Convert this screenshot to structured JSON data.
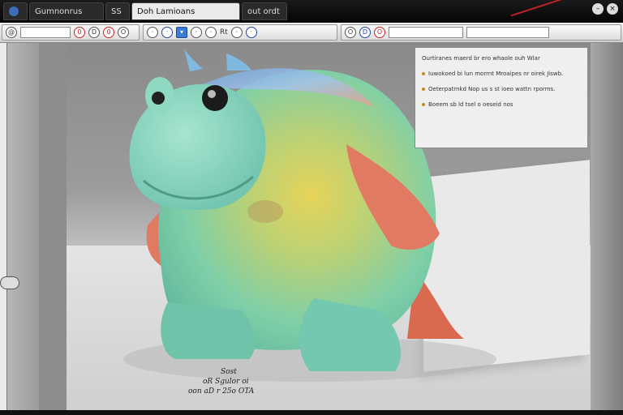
{
  "title_tabs": [
    "Gumnonrus",
    "SS",
    "Doh Lamioans",
    "out ordt"
  ],
  "window_controls": [
    "min",
    "max",
    "close"
  ],
  "toolbar": {
    "left_labels": [
      "@",
      "0",
      "D",
      "0",
      "O"
    ],
    "middle_label": "Rt",
    "right_labels": [
      "O",
      "D",
      "O"
    ]
  },
  "note": {
    "intro": "Ourtiranes maerd br ero whaole ouh Wlar",
    "items": [
      "Iuwokoed bi lun morrnt Mroaipes nr oirek Jiswb.",
      "Oeterpatrnkd Nop us s st ioeo wattn rporms.",
      "Boeem sb ld tsel o oeseid nos"
    ]
  },
  "caption": {
    "line1": "Sost",
    "line2": "oR Sgulor oi",
    "line3": "oon aD r 25o OTA"
  },
  "colors": {
    "titlebar": "#0a0a0a",
    "toolbar": "#dcdcdc",
    "selected": "#3a7bd5",
    "creature_teal": "#7fcfb7",
    "creature_fin": "#e0735c"
  }
}
